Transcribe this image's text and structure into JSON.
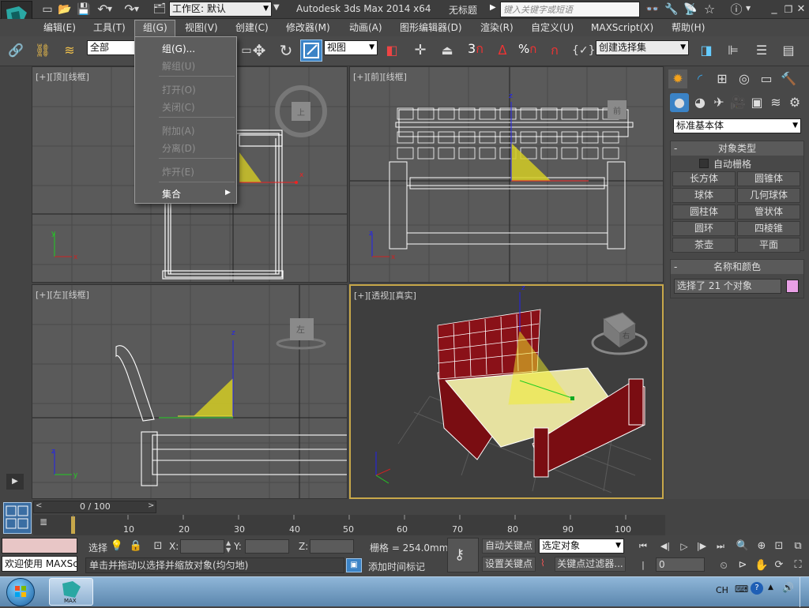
{
  "title_bar": {
    "workspace_label": "工作区: 默认",
    "app_title": "Autodesk 3ds Max  2014 x64",
    "doc_title": "无标题",
    "search_placeholder": "键入关键字或短语"
  },
  "menubar": {
    "items": [
      "编辑(E)",
      "工具(T)",
      "组(G)",
      "视图(V)",
      "创建(C)",
      "修改器(M)",
      "动画(A)",
      "图形编辑器(D)",
      "渲染(R)",
      "自定义(U)",
      "MAXScript(X)",
      "帮助(H)"
    ]
  },
  "group_menu": {
    "items": [
      {
        "label": "组(G)...",
        "enabled": true
      },
      {
        "label": "解组(U)",
        "enabled": false
      },
      {
        "label": "打开(O)",
        "enabled": false
      },
      {
        "label": "关闭(C)",
        "enabled": false
      },
      {
        "label": "附加(A)",
        "enabled": false
      },
      {
        "label": "分离(D)",
        "enabled": false
      },
      {
        "label": "炸开(E)",
        "enabled": false
      },
      {
        "label": "集合",
        "enabled": true
      }
    ]
  },
  "toolbar": {
    "filter_value": "全部",
    "refcoord_value": "视图",
    "snap_label": "3",
    "percent_label": "%",
    "named_selection_placeholder": "创建选择集"
  },
  "viewports": {
    "top": {
      "label": "[+][顶][线框]",
      "cube": "上"
    },
    "front": {
      "label": "[+][前][线框]",
      "cube": "前"
    },
    "left": {
      "label": "[+][左][线框]",
      "cube": "左"
    },
    "perspective": {
      "label": "[+][透视][真实]",
      "cube": "右"
    }
  },
  "axis_labels": {
    "x": "x",
    "y": "y",
    "z": "z"
  },
  "command_panel": {
    "category_value": "标准基本体",
    "object_type_header": "对象类型",
    "autogrid_label": "自动栅格",
    "buttons": [
      "长方体",
      "圆锥体",
      "球体",
      "几何球体",
      "圆柱体",
      "管状体",
      "圆环",
      "四棱锥",
      "茶壶",
      "平面"
    ],
    "name_color_header": "名称和颜色",
    "name_value": "选择了 21 个对象",
    "object_color": "#e9a0e6"
  },
  "timeline": {
    "frame_display": "0 / 100",
    "ticks": [
      "10",
      "20",
      "30",
      "40",
      "50",
      "60",
      "70",
      "80",
      "90",
      "100"
    ]
  },
  "status": {
    "maxscript_listener": "欢迎使用 MAXSc",
    "select_label": "选择",
    "x_label": "X:",
    "y_label": "Y:",
    "z_label": "Z:",
    "grid_text": "栅格 = 254.0mm",
    "prompt_text": "单击并拖动以选择并缩放对象(均匀地)",
    "add_time_tag": "添加时间标记",
    "auto_key": "自动关键点",
    "set_key": "设置关键点",
    "key_mode_value": "选定对象",
    "key_filters": "关键点过滤器...",
    "current_frame": "0"
  },
  "taskbar": {
    "lang": "CH",
    "app_label": "MAX"
  }
}
